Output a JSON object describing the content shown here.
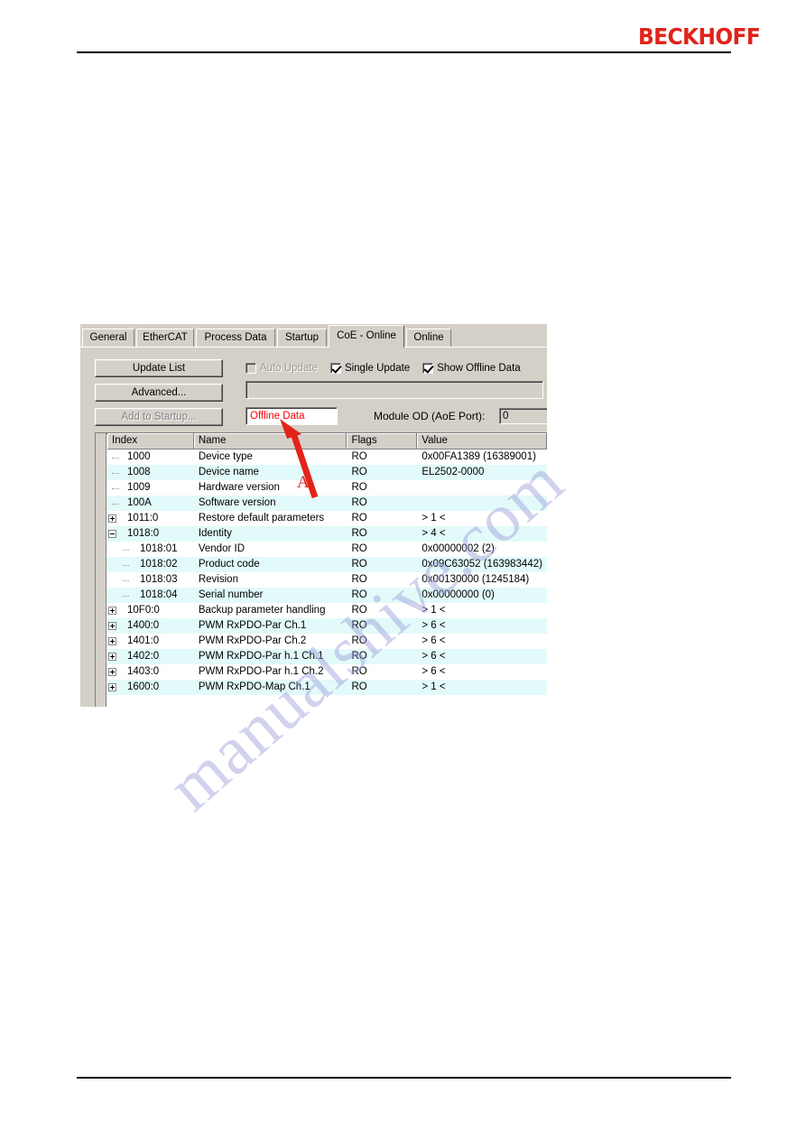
{
  "page": {
    "brand": "BECKHOFF"
  },
  "watermark": {
    "text": "manualshive.com"
  },
  "dialog": {
    "tabs": [
      {
        "label": "General",
        "active": false
      },
      {
        "label": "EtherCAT",
        "active": false
      },
      {
        "label": "Process Data",
        "active": false
      },
      {
        "label": "Startup",
        "active": false
      },
      {
        "label": "CoE - Online",
        "active": true
      },
      {
        "label": "Online",
        "active": false
      }
    ],
    "buttons": {
      "update_list": "Update List",
      "advanced": "Advanced...",
      "add_to_startup": "Add to Startup..."
    },
    "checkboxes": [
      {
        "label": "Auto Update",
        "checked": false,
        "disabled": true
      },
      {
        "label": "Single Update",
        "checked": true,
        "disabled": false
      },
      {
        "label": "Show Offline Data",
        "checked": true,
        "disabled": false
      }
    ],
    "progress_field_value": "",
    "status_field": {
      "value": "Offline Data",
      "color": "#ff0000"
    },
    "module_od": {
      "label": "Module OD (AoE Port):",
      "value": "0"
    }
  },
  "object_list": {
    "columns": [
      "Index",
      "Name",
      "Flags",
      "Value"
    ],
    "rows": [
      {
        "index": "1000",
        "name": "Device type",
        "flags": "RO",
        "value": "0x00FA1389 (16389001)",
        "depth": 0,
        "node": "leaf"
      },
      {
        "index": "1008",
        "name": "Device name",
        "flags": "RO",
        "value": "EL2502-0000",
        "depth": 0,
        "node": "leaf"
      },
      {
        "index": "1009",
        "name": "Hardware version",
        "flags": "RO",
        "value": "",
        "depth": 0,
        "node": "leaf"
      },
      {
        "index": "100A",
        "name": "Software version",
        "flags": "RO",
        "value": "",
        "depth": 0,
        "node": "leaf"
      },
      {
        "index": "1011:0",
        "name": "Restore default parameters",
        "flags": "RO",
        "value": "> 1 <",
        "depth": 0,
        "node": "plus"
      },
      {
        "index": "1018:0",
        "name": "Identity",
        "flags": "RO",
        "value": "> 4 <",
        "depth": 0,
        "node": "minus"
      },
      {
        "index": "1018:01",
        "name": "Vendor ID",
        "flags": "RO",
        "value": "0x00000002 (2)",
        "depth": 1,
        "node": "leaf"
      },
      {
        "index": "1018:02",
        "name": "Product code",
        "flags": "RO",
        "value": "0x09C63052 (163983442)",
        "depth": 1,
        "node": "leaf"
      },
      {
        "index": "1018:03",
        "name": "Revision",
        "flags": "RO",
        "value": "0x00130000 (1245184)",
        "depth": 1,
        "node": "leaf"
      },
      {
        "index": "1018:04",
        "name": "Serial number",
        "flags": "RO",
        "value": "0x00000000 (0)",
        "depth": 1,
        "node": "leaf"
      },
      {
        "index": "10F0:0",
        "name": "Backup parameter handling",
        "flags": "RO",
        "value": "> 1 <",
        "depth": 0,
        "node": "plus"
      },
      {
        "index": "1400:0",
        "name": "PWM RxPDO-Par Ch.1",
        "flags": "RO",
        "value": "> 6 <",
        "depth": 0,
        "node": "plus"
      },
      {
        "index": "1401:0",
        "name": "PWM RxPDO-Par Ch.2",
        "flags": "RO",
        "value": "> 6 <",
        "depth": 0,
        "node": "plus"
      },
      {
        "index": "1402:0",
        "name": "PWM RxPDO-Par h.1 Ch.1",
        "flags": "RO",
        "value": "> 6 <",
        "depth": 0,
        "node": "plus"
      },
      {
        "index": "1403:0",
        "name": "PWM RxPDO-Par h.1 Ch.2",
        "flags": "RO",
        "value": "> 6 <",
        "depth": 0,
        "node": "plus"
      },
      {
        "index": "1600:0",
        "name": "PWM RxPDO-Map Ch.1",
        "flags": "RO",
        "value": "> 1 <",
        "depth": 0,
        "node": "plus"
      }
    ]
  },
  "annotation": {
    "label": "A",
    "color": "#e2231a"
  }
}
